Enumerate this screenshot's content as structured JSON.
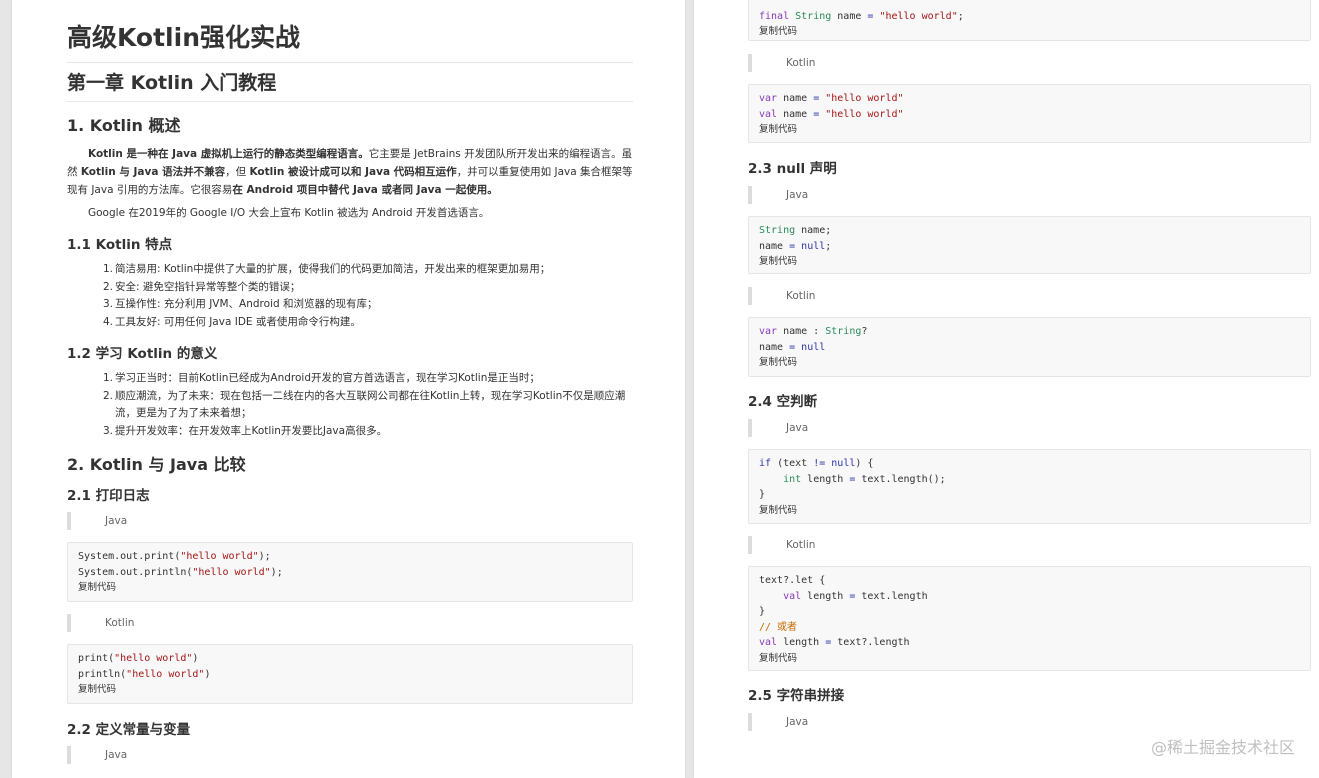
{
  "title": "高级Kotlin强化实战",
  "chapter": "第一章 Kotlin 入门教程",
  "sec1": {
    "heading": "1. Kotlin 概述",
    "para1": [
      {
        "b": true,
        "t": "Kotlin 是一种在 Java 虚拟机上运行的静态类型编程语言。"
      },
      {
        "b": false,
        "t": "它主要是 JetBrains 开发团队所开发出来的编程语言。虽然 "
      },
      {
        "b": true,
        "t": "Kotlin 与 Java 语法并不兼容"
      },
      {
        "b": false,
        "t": "，但 "
      },
      {
        "b": true,
        "t": "Kotlin 被设计成可以和 Java 代码相互运作"
      },
      {
        "b": false,
        "t": "，并可以重复使用如 Java 集合框架等现有 Java 引用的方法库。它很容易"
      },
      {
        "b": true,
        "t": "在 Android 项目中替代 Java 或者同 Java 一起使用。"
      }
    ],
    "para2": "Google 在2019年的 Google I/O 大会上宣布 Kotlin 被选为 Android 开发首选语言。"
  },
  "sec1_1": {
    "heading": "1.1 Kotlin 特点",
    "items": [
      "简洁易用: Kotlin中提供了大量的扩展，使得我们的代码更加简洁，开发出来的框架更加易用；",
      "安全: 避免空指针异常等整个类的错误；",
      "互操作性: 充分利用 JVM、Android 和浏览器的现有库；",
      "工具友好: 可用任何 Java IDE 或者使用命令行构建。"
    ]
  },
  "sec1_2": {
    "heading": "1.2 学习 Kotlin 的意义",
    "items": [
      "学习正当时：目前Kotlin已经成为Android开发的官方首选语言，现在学习Kotlin是正当时；",
      "顺应潮流，为了未来：现在包括一二线在内的各大互联网公司都在往Kotlin上转，现在学习Kotlin不仅是顺应潮流，更是为了为了未来着想；",
      "提升开发效率：在开发效率上Kotlin开发要比Java高很多。"
    ]
  },
  "sec2": {
    "heading": "2. Kotlin 与 Java 比较"
  },
  "sec2_1": {
    "heading": "2.1 打印日志",
    "java_label": "Java",
    "java_code": [
      "System.out.print(\"hello world\");",
      "System.out.println(\"hello world\");"
    ],
    "kotlin_label": "Kotlin",
    "kotlin_code": [
      "print(\"hello world\")",
      "println(\"hello world\")"
    ]
  },
  "sec2_2": {
    "heading": "2.2 定义常量与变量",
    "java_label": "Java",
    "java_code_tail": "final String name = \"hello world\";",
    "kotlin_label": "Kotlin",
    "kotlin_code": [
      "var name = \"hello world\"",
      "val name = \"hello world\""
    ]
  },
  "sec2_3": {
    "heading": "2.3 null 声明",
    "java_label": "Java",
    "java_code": [
      "String name;",
      "name = null;"
    ],
    "kotlin_label": "Kotlin",
    "kotlin_code": [
      "var name : String?",
      "name = null"
    ]
  },
  "sec2_4": {
    "heading": "2.4 空判断",
    "java_label": "Java",
    "java_code": [
      "if (text != null) {",
      "    int length = text.length();",
      "}"
    ],
    "kotlin_label": "Kotlin",
    "kotlin_code": [
      "text?.let {",
      "    val length = text.length",
      "}",
      "// 或者",
      "val length = text?.length"
    ]
  },
  "sec2_5": {
    "heading": "2.5 字符串拼接",
    "java_label": "Java"
  },
  "copy_label": "复制代码",
  "watermark": "@稀土掘金技术社区"
}
